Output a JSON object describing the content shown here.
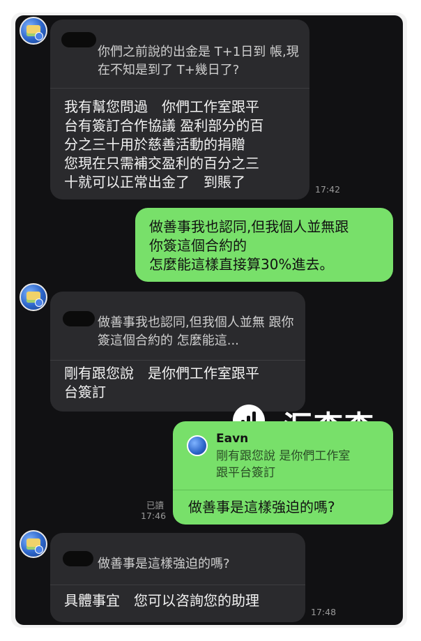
{
  "messages": [
    {
      "quote": "你們之前說的出金是 T+1日到\n帳,現在不知是到了 T+幾日了?",
      "text": "我有幫您問過　你們工作室跟平\n台有簽訂合作協議 盈利部分的百\n分之三十用於慈善活動的捐贈\n您現在只需補交盈利的百分之三\n十就可以正常出金了　到賬了",
      "time": "17:42"
    },
    {
      "text": "做善事我也認同,但我個人並無跟\n你簽這個合約的\n怎麼能這樣直接算30%進去。"
    },
    {
      "quote": "做善事我也認同,但我個人並無\n跟你簽這個合約的 怎麼能這...",
      "text": "剛有跟您說　是你們工作室跟平\n台簽訂"
    },
    {
      "quote_author": "Eavn",
      "quote": "剛有跟您說 是你們工作室\n跟平台簽訂",
      "text": "做善事是這樣強迫的嗎?",
      "read": "已讀",
      "time": "17:46"
    },
    {
      "quote": "做善事是這樣強迫的嗎?",
      "text": "具體事宜　您可以咨詢您的助理",
      "time": "17:48"
    }
  ],
  "watermark": {
    "text": "汇查查"
  },
  "colors": {
    "chat_bg": "#111113",
    "incoming": "#2a2a2d",
    "outgoing": "#78e06a"
  }
}
